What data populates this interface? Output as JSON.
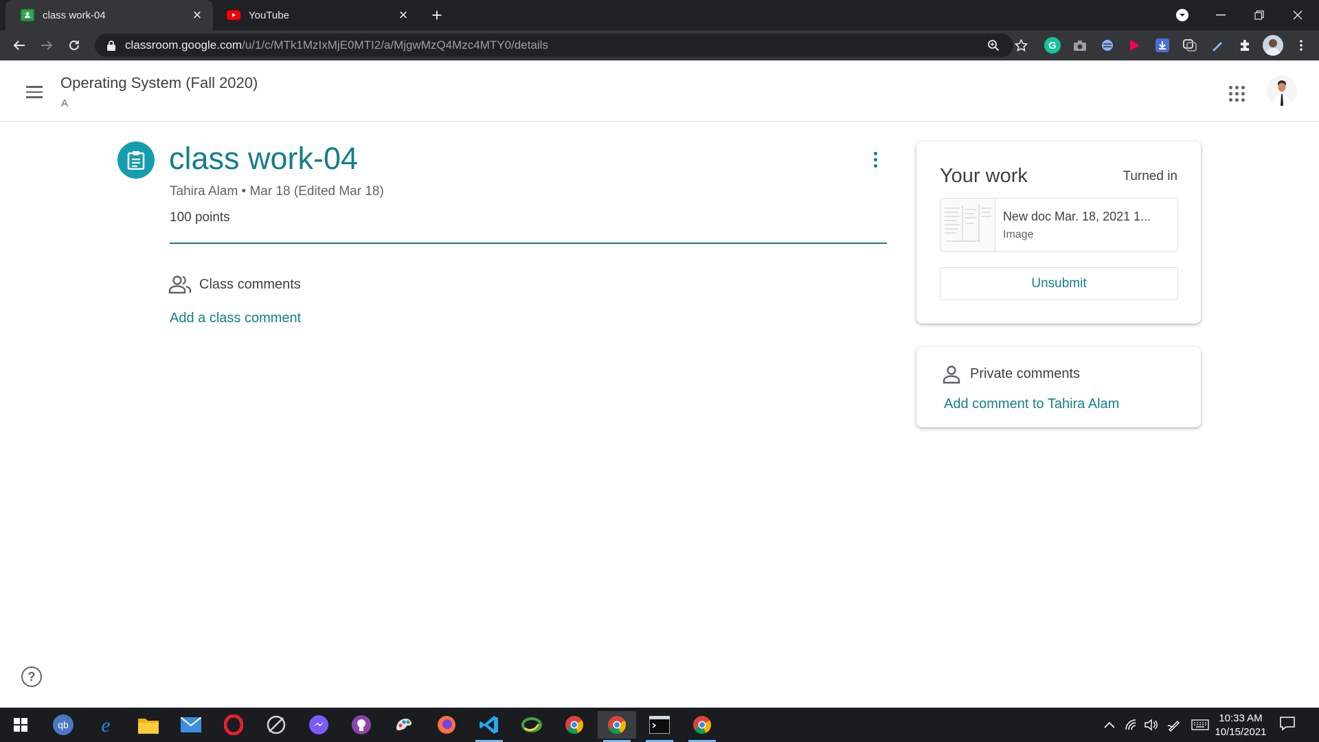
{
  "browser": {
    "tabs": [
      {
        "title": "class work-04",
        "favicon": "google-classroom-icon",
        "active": true
      },
      {
        "title": "YouTube",
        "favicon": "youtube-icon",
        "active": false
      }
    ],
    "url_host": "classroom.google.com",
    "url_path": "/u/1/c/MTk1MzIxMjE0MTI2/a/MjgwMzQ4Mzc4MTY0/details"
  },
  "header": {
    "course_title": "Operating System (Fall 2020)",
    "course_section": "A"
  },
  "assignment": {
    "title": "class work-04",
    "meta": "Tahira Alam • Mar 18 (Edited Mar 18)",
    "points": "100 points",
    "class_comments_label": "Class comments",
    "add_class_comment": "Add a class comment"
  },
  "your_work": {
    "title": "Your work",
    "status": "Turned in",
    "attachment_name": "New doc Mar. 18, 2021 1...",
    "attachment_type": "Image",
    "unsubmit_label": "Unsubmit"
  },
  "private_comments": {
    "label": "Private comments",
    "add_label": "Add comment to Tahira Alam"
  },
  "taskbar": {
    "time": "10:33 AM",
    "date": "10/15/2021"
  },
  "colors": {
    "accent": "#137e8b",
    "assignment_icon_bg": "#129eaf",
    "tab_bar": "#202124",
    "toolbar": "#35363a",
    "taskbar": "#1a1c1f"
  }
}
